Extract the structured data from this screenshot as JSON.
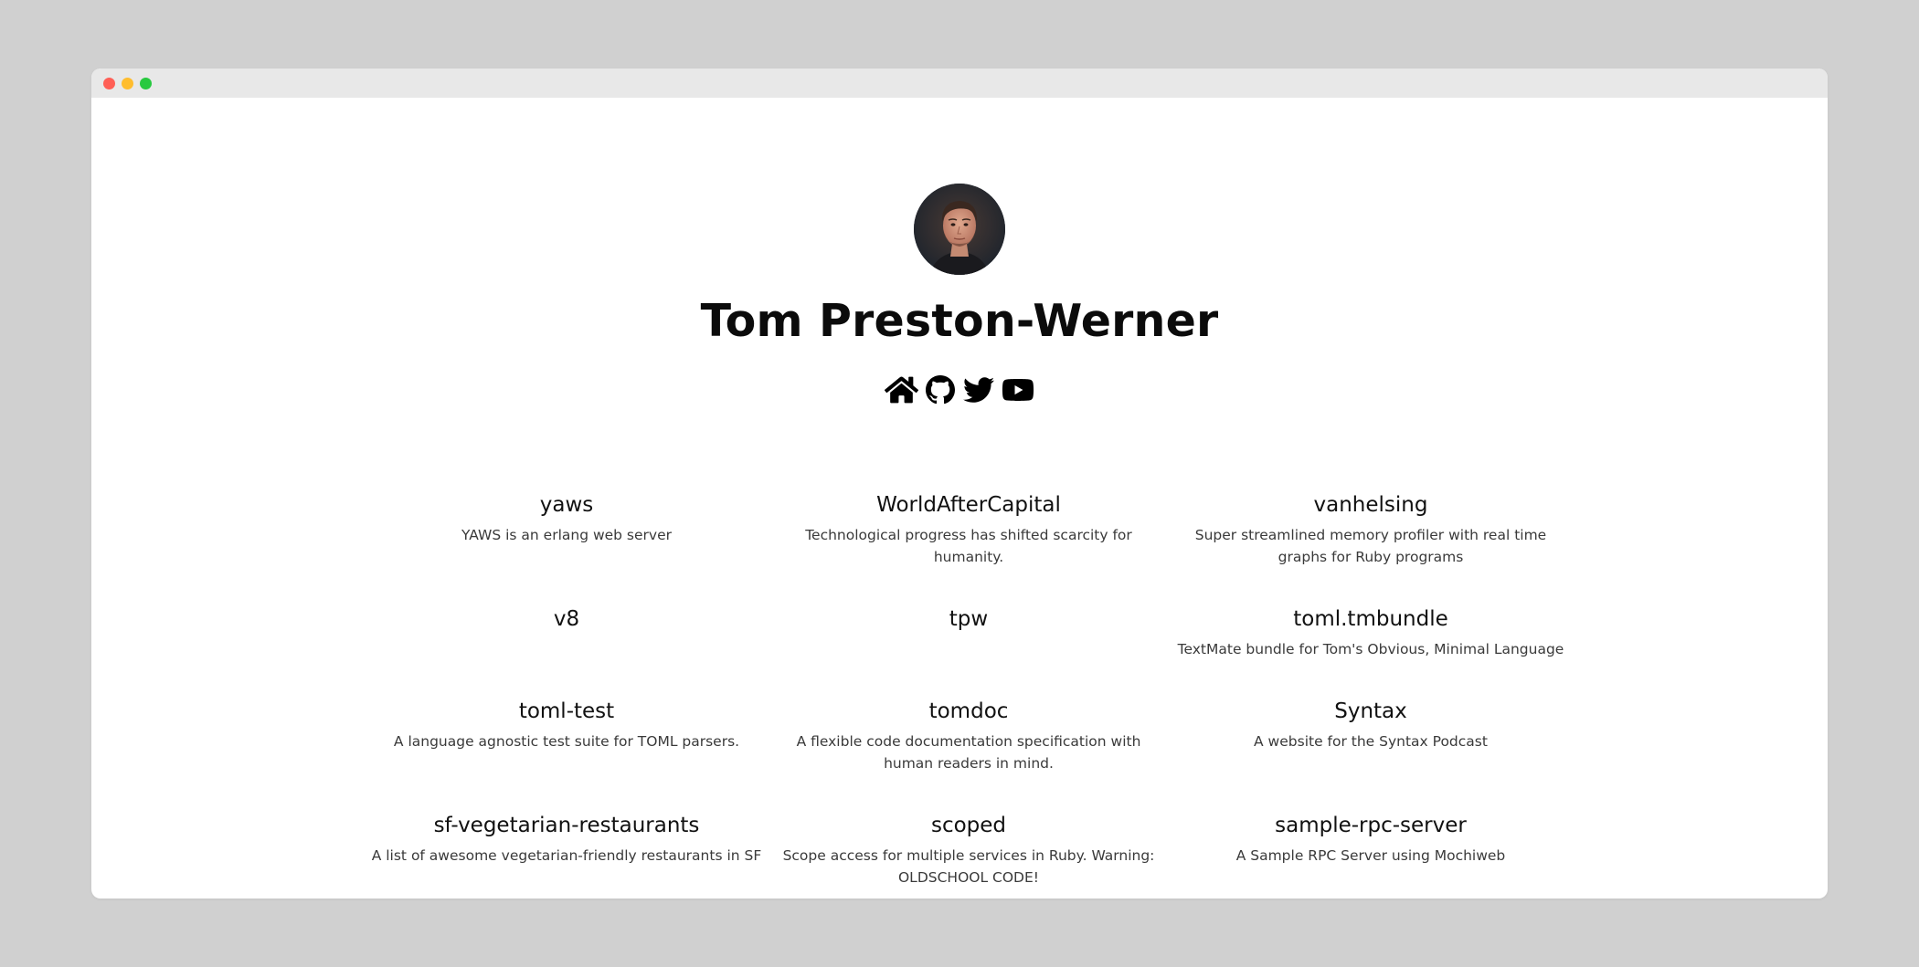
{
  "window": {
    "traffic_lights": {
      "close_color": "#ff5f56",
      "minimize_color": "#ffbd2e",
      "maximize_color": "#27c93f"
    }
  },
  "profile": {
    "name": "Tom Preston-Werner",
    "avatar_icon": "avatar-photo",
    "social_links": [
      {
        "icon": "home-icon"
      },
      {
        "icon": "github-icon"
      },
      {
        "icon": "twitter-icon"
      },
      {
        "icon": "youtube-icon"
      }
    ]
  },
  "repos": [
    {
      "name": "yaws",
      "description": "YAWS is an erlang web server"
    },
    {
      "name": "WorldAfterCapital",
      "description": "Technological progress has shifted scarcity for humanity."
    },
    {
      "name": "vanhelsing",
      "description": "Super streamlined memory profiler with real time graphs for Ruby programs"
    },
    {
      "name": "v8",
      "description": ""
    },
    {
      "name": "tpw",
      "description": ""
    },
    {
      "name": "toml.tmbundle",
      "description": "TextMate bundle for Tom's Obvious, Minimal Language"
    },
    {
      "name": "toml-test",
      "description": "A language agnostic test suite for TOML parsers."
    },
    {
      "name": "tomdoc",
      "description": "A flexible code documentation specification with human readers in mind."
    },
    {
      "name": "Syntax",
      "description": "A website for the Syntax Podcast"
    },
    {
      "name": "sf-vegetarian-restaurants",
      "description": "A list of awesome vegetarian-friendly restaurants in SF"
    },
    {
      "name": "scoped",
      "description": "Scope access for multiple services in Ruby. Warning: OLDSCHOOL CODE!"
    },
    {
      "name": "sample-rpc-server",
      "description": "A Sample RPC Server using Mochiweb"
    }
  ]
}
